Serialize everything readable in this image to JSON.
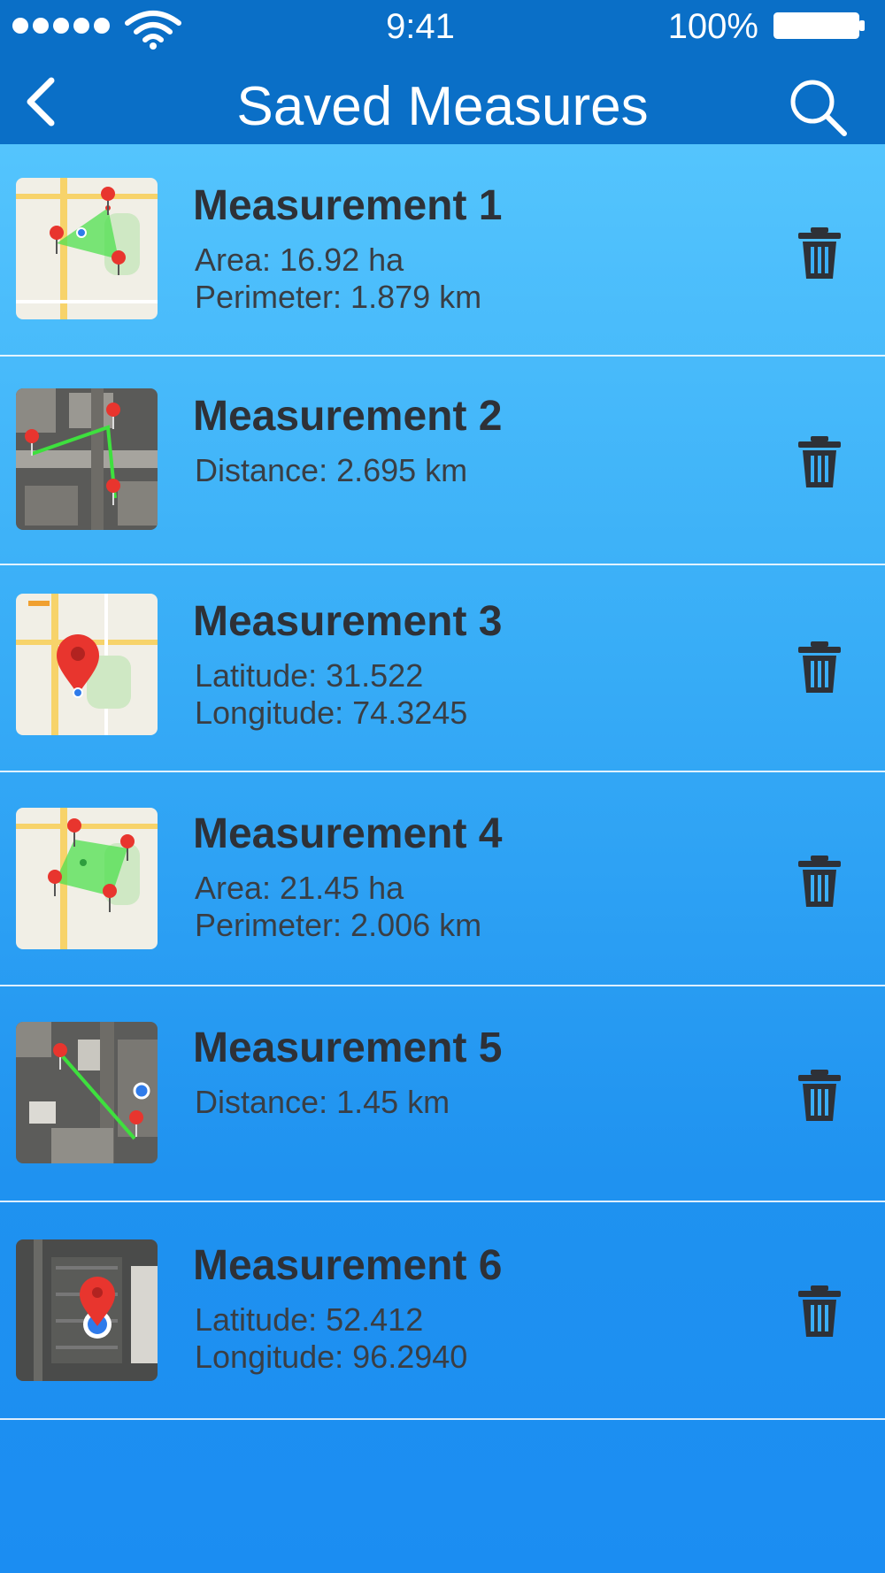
{
  "status_bar": {
    "time": "9:41",
    "battery": "100%",
    "signal_icon": "signal-dots-icon",
    "wifi_icon": "wifi-icon",
    "battery_icon": "battery-icon"
  },
  "header": {
    "title": "Saved Measures",
    "back_icon": "back-chevron-icon",
    "search_icon": "search-icon",
    "bar_color": "#0a6fc7"
  },
  "measurements": [
    {
      "name": "Measurement 1",
      "line1": "Area: 16.92 ha",
      "line2": "Perimeter: 1.879 km",
      "thumbnail": "map-area-thumbnail"
    },
    {
      "name": "Measurement 2",
      "line1": "Distance: 2.695 km",
      "line2": "",
      "thumbnail": "satellite-distance-thumbnail"
    },
    {
      "name": "Measurement 3",
      "line1": "Latitude: 31.522",
      "line2": "Longitude: 74.3245",
      "thumbnail": "map-pin-thumbnail"
    },
    {
      "name": "Measurement 4",
      "line1": "Area: 21.45 ha",
      "line2": "Perimeter: 2.006 km",
      "thumbnail": "map-area-thumbnail"
    },
    {
      "name": "Measurement 5",
      "line1": "Distance: 1.45 km",
      "line2": "",
      "thumbnail": "satellite-distance-thumbnail"
    },
    {
      "name": "Measurement 6",
      "line1": "Latitude: 52.412",
      "line2": "Longitude: 96.2940",
      "thumbnail": "satellite-pin-thumbnail"
    }
  ],
  "row_action_icon": "trash-icon",
  "colors": {
    "gradient_top": "#5ccbff",
    "gradient_bottom": "#1b8df2",
    "text_dark": "#2e3137",
    "pin_red": "#e8352e",
    "area_green": "#4fe04f"
  }
}
